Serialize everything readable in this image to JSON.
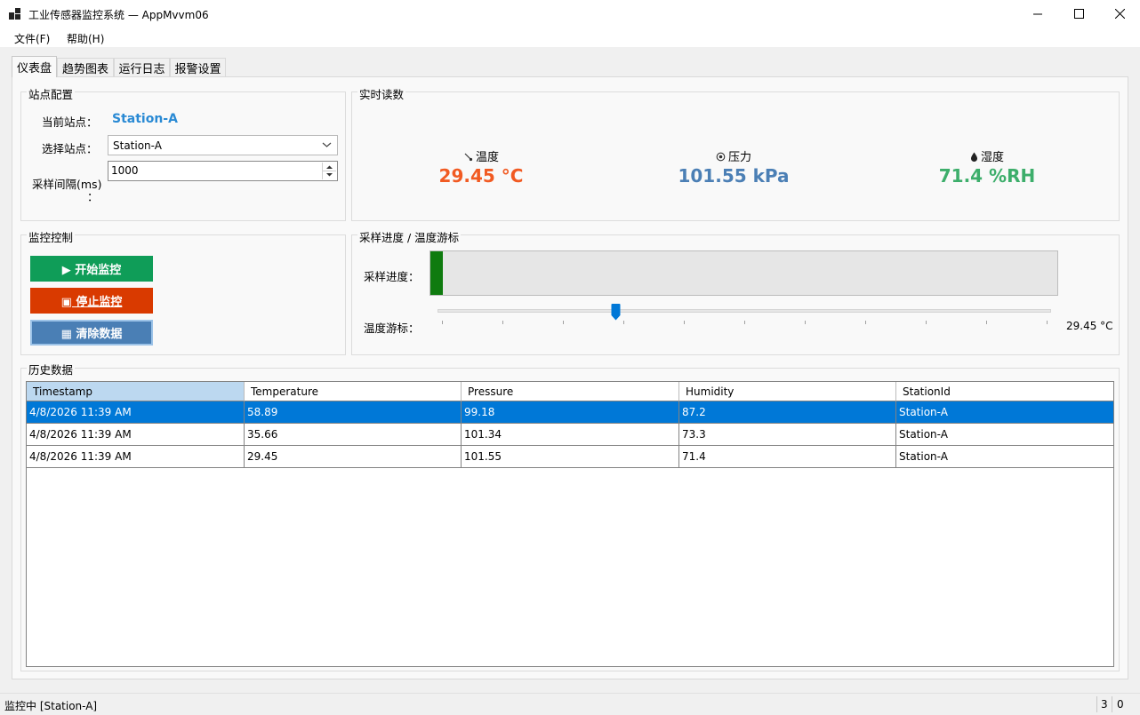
{
  "window": {
    "title": "工业传感器监控系统 — AppMvvm06"
  },
  "menu": {
    "file": "文件(F)",
    "help": "帮助(H)"
  },
  "tabs": [
    "仪表盘",
    "趋势图表",
    "运行日志",
    "报警设置"
  ],
  "station_config": {
    "title": "站点配置",
    "current_label": "当前站点：",
    "current_value": "Station-A",
    "select_label": "选择站点：",
    "select_value": "Station-A",
    "interval_label_line1": "采样间隔(ms)",
    "interval_label_line2": "：",
    "interval_value": "1000"
  },
  "readings": {
    "title": "实时读数",
    "temperature": {
      "icon": "thermometer-icon",
      "label": "温度",
      "value": "29.45 °C",
      "color": "#f15a22"
    },
    "pressure": {
      "icon": "gauge-icon",
      "label": "压力",
      "value": "101.55 kPa",
      "color": "#4b7fb5"
    },
    "humidity": {
      "icon": "droplet-icon",
      "label": "湿度",
      "value": "71.4 %RH",
      "color": "#3dae6b"
    }
  },
  "control": {
    "title": "监控控制",
    "start": "▶ 开始监控",
    "stop": "▣ 停止监控",
    "clear": "▦ 清除数据",
    "colors": {
      "start": "#0f9d58",
      "stop": "#d93a00",
      "clear": "#4a7fb5"
    }
  },
  "progress_panel": {
    "title": "采样进度 / 温度游标",
    "progress_label": "采样进度：",
    "progress_fraction": 0.02,
    "cursor_label": "温度游标：",
    "cursor_value": "29.45 °C",
    "slider_fraction": 0.29
  },
  "history": {
    "title": "历史数据",
    "columns": [
      "Timestamp",
      "Temperature",
      "Pressure",
      "Humidity",
      "StationId"
    ],
    "rows": [
      [
        "4/8/2026 11:39 AM",
        "58.89",
        "99.18",
        "87.2",
        "Station-A"
      ],
      [
        "4/8/2026 11:39 AM",
        "35.66",
        "101.34",
        "73.3",
        "Station-A"
      ],
      [
        "4/8/2026 11:39 AM",
        "29.45",
        "101.55",
        "71.4",
        "Station-A"
      ]
    ]
  },
  "status": {
    "text": "监控中 [Station-A]",
    "count": "3",
    "errors": "0"
  }
}
